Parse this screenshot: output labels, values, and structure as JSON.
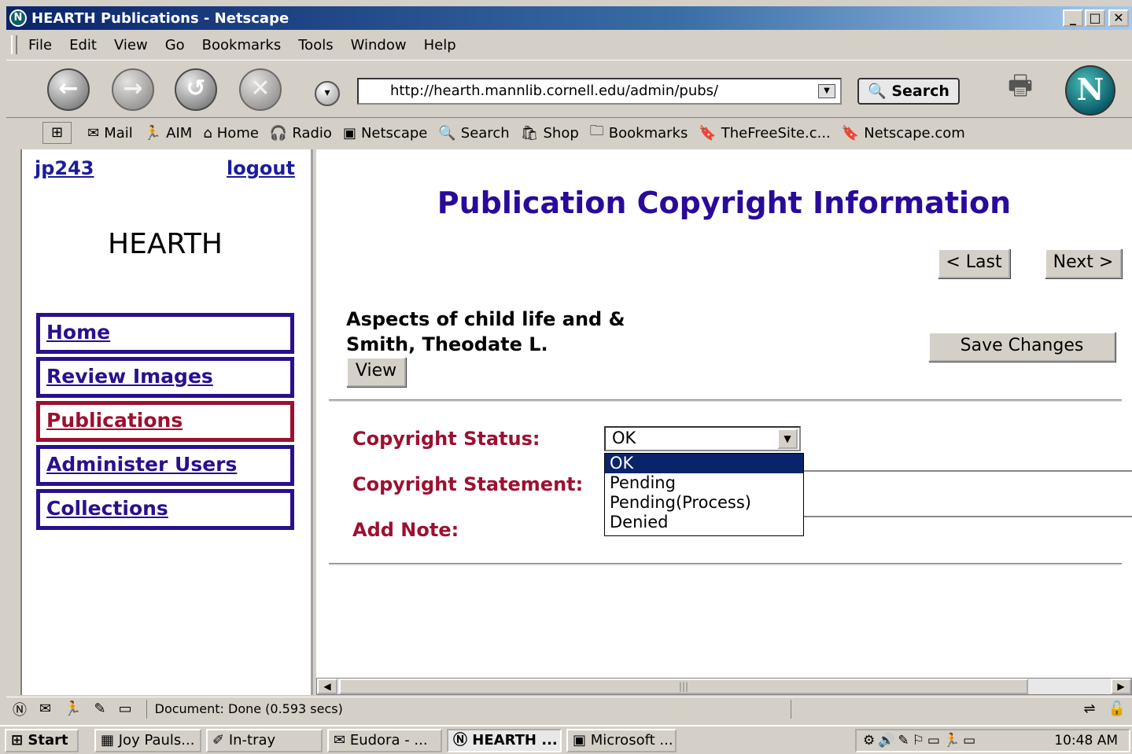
{
  "window": {
    "title": "HEARTH Publications - Netscape",
    "buttons": {
      "minimize": "_",
      "maximize": "□",
      "close": "✕"
    }
  },
  "menu": [
    "File",
    "Edit",
    "View",
    "Go",
    "Bookmarks",
    "Tools",
    "Window",
    "Help"
  ],
  "navigation": {
    "url": "http://hearth.mannlib.cornell.edu/admin/pubs/",
    "search_label": "Search"
  },
  "personal_toolbar": [
    {
      "icon": "mail-icon",
      "label": "Mail"
    },
    {
      "icon": "aim-icon",
      "label": "AIM"
    },
    {
      "icon": "home-icon",
      "label": "Home"
    },
    {
      "icon": "radio-icon",
      "label": "Radio"
    },
    {
      "icon": "mynetscape-icon",
      "label": "Netscape"
    },
    {
      "icon": "search-icon",
      "label": "Search"
    },
    {
      "icon": "shop-icon",
      "label": "Shop"
    },
    {
      "icon": "folder-icon",
      "label": "Bookmarks"
    },
    {
      "icon": "bookmark-icon",
      "label": "TheFreeSite.c..."
    },
    {
      "icon": "bookmark-icon",
      "label": "Netscape.com"
    }
  ],
  "sidebar": {
    "user": "jp243",
    "logout": "logout",
    "brand": "HEARTH",
    "nav": [
      {
        "label": "Home",
        "active": false
      },
      {
        "label": "Review Images",
        "active": false
      },
      {
        "label": "Publications",
        "active": true
      },
      {
        "label": "Administer Users",
        "active": false
      },
      {
        "label": "Collections",
        "active": false
      }
    ]
  },
  "main": {
    "title": "Publication Copyright Information",
    "last_label": "< Last",
    "next_label": "Next >",
    "book_title": "Aspects of child life and &",
    "book_author": "Smith, Theodate L.",
    "view_label": "View",
    "save_label": "Save Changes",
    "fields": {
      "status_label": "Copyright Status:",
      "statement_label": "Copyright Statement:",
      "note_label": "Add Note:"
    },
    "status_value": "OK",
    "status_options": [
      "OK",
      "Pending",
      "Pending(Process)",
      "Denied"
    ],
    "status_selected_index": 0
  },
  "statusbar": {
    "text": "Document: Done (0.593 secs)"
  },
  "taskbar": {
    "start": "Start",
    "tasks": [
      {
        "label": "Joy Pauls...",
        "active": false
      },
      {
        "label": "In-tray",
        "active": false
      },
      {
        "label": "Eudora - ...",
        "active": false
      },
      {
        "label": "HEARTH ...",
        "active": true
      },
      {
        "label": "Microsoft ...",
        "active": false
      }
    ],
    "clock": "10:48 AM"
  }
}
